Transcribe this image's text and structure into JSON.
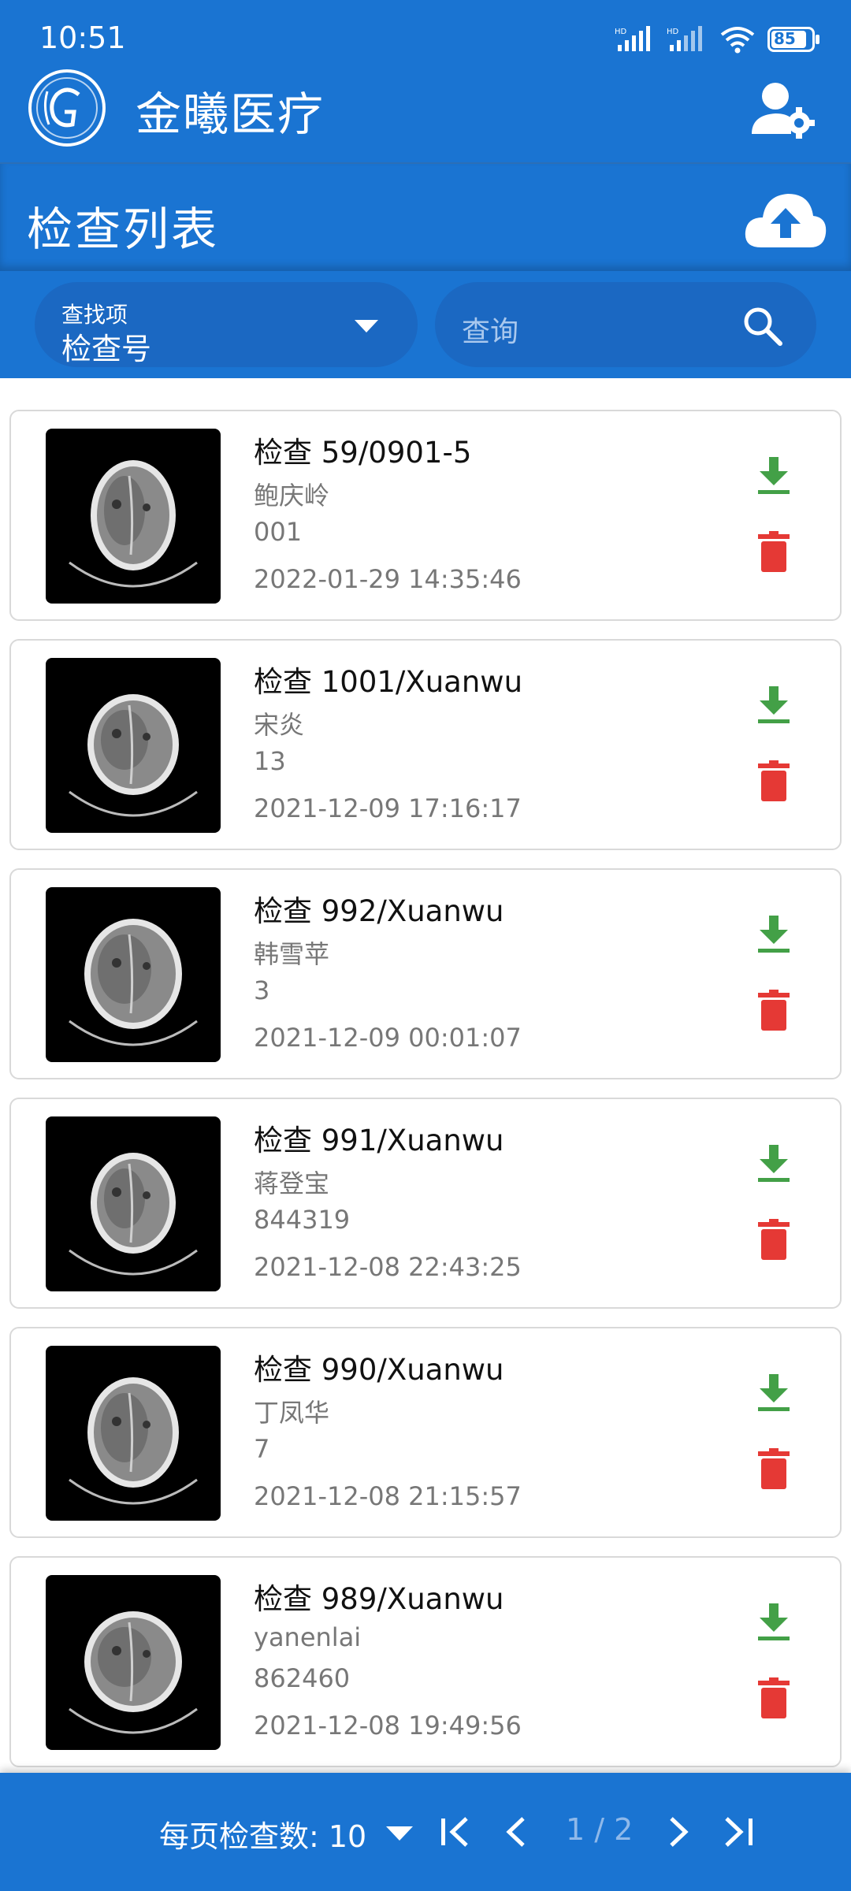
{
  "status_bar": {
    "time": "10:51",
    "battery": "85"
  },
  "app": {
    "title": "金曦医疗"
  },
  "header": {
    "title": "检查列表"
  },
  "filter": {
    "field_label": "查找项",
    "field_value": "检查号",
    "search_placeholder": "查询"
  },
  "records": [
    {
      "title": "检查 59/0901-5",
      "name": "鲍庆岭",
      "number": "001",
      "datetime": "2022-01-29 14:35:46"
    },
    {
      "title": "检查 1001/Xuanwu",
      "name": "宋炎",
      "number": "13",
      "datetime": "2021-12-09 17:16:17"
    },
    {
      "title": "检查 992/Xuanwu",
      "name": "韩雪苹",
      "number": "3",
      "datetime": "2021-12-09 00:01:07"
    },
    {
      "title": "检查 991/Xuanwu",
      "name": "蒋登宝",
      "number": "844319",
      "datetime": "2021-12-08 22:43:25"
    },
    {
      "title": "检查 990/Xuanwu",
      "name": "丁凤华",
      "number": "7",
      "datetime": "2021-12-08 21:15:57"
    },
    {
      "title": "检查 989/Xuanwu",
      "name": "yanenlai",
      "number": "862460",
      "datetime": "2021-12-08 19:49:56"
    }
  ],
  "pagination": {
    "per_page_label": "每页检查数: 10",
    "page_indicator": "1 / 2"
  },
  "colors": {
    "primary": "#1a74d2",
    "download": "#43a047",
    "delete": "#e53935"
  },
  "icons": {
    "header": [
      "logo-icon",
      "user-settings-icon",
      "cloud-upload-icon"
    ],
    "filter": [
      "dropdown-caret-icon",
      "search-icon"
    ],
    "card": [
      "download-icon",
      "delete-icon"
    ],
    "pager": [
      "first-page-icon",
      "prev-page-icon",
      "next-page-icon",
      "last-page-icon"
    ]
  }
}
